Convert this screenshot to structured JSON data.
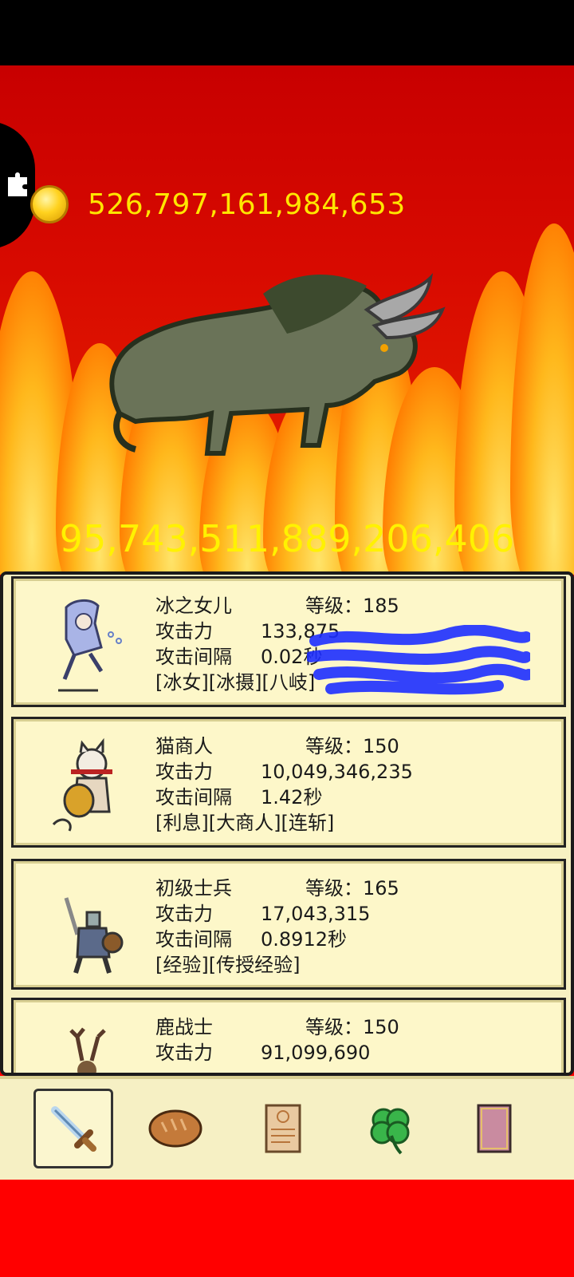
{
  "gold": "526,797,161,984,653",
  "boss_hp": "95,743,511,889,206,406",
  "heroes": [
    {
      "name": "冰之女儿",
      "level_label": "等级：185",
      "attack_label": "攻击力",
      "attack": "133,875",
      "interval_label": "攻击间隔",
      "interval": "0.02秒",
      "tags": "[冰女][冰摄][八岐]"
    },
    {
      "name": "猫商人",
      "level_label": "等级：150",
      "attack_label": "攻击力",
      "attack": "10,049,346,235",
      "interval_label": "攻击间隔",
      "interval": "1.42秒",
      "tags": "[利息][大商人][连斩]"
    },
    {
      "name": "初级士兵",
      "level_label": "等级：165",
      "attack_label": "攻击力",
      "attack": "17,043,315",
      "interval_label": "攻击间隔",
      "interval": "0.8912秒",
      "tags": "[经验][传授经验]"
    },
    {
      "name": "鹿战士",
      "level_label": "等级：150",
      "attack_label": "攻击力",
      "attack": "91,099,690",
      "interval_label": "",
      "interval": "",
      "tags": ""
    }
  ],
  "tabs": [
    {
      "icon": "sword-icon",
      "active": true
    },
    {
      "icon": "bread-icon",
      "active": false
    },
    {
      "icon": "scroll-icon",
      "active": false
    },
    {
      "icon": "clover-icon",
      "active": false
    },
    {
      "icon": "book-icon",
      "active": false
    }
  ],
  "colors": {
    "gold_text": "#ffe600",
    "boss_hp_text": "#fff200",
    "panel_bg": "#fdf7c9",
    "battle_bg": "#d80a00"
  }
}
